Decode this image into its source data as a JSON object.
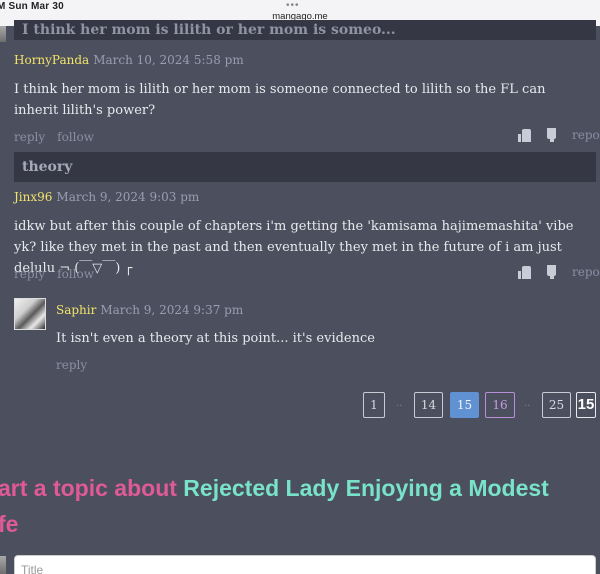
{
  "status_bar": {
    "time": "M  Sun Mar 30",
    "dots": "•••",
    "url": "mangago.me"
  },
  "comments": [
    {
      "topic_title": "I think her mom is lilith or her mom is someo...",
      "user": "HornyPanda",
      "date": "March 10, 2024 5:58 pm",
      "text": "I think her mom is lilith or her mom is someone connected to lilith so the FL can inherit lilith's power?",
      "reply_label": "reply",
      "follow_label": "follow",
      "report_label": "report"
    },
    {
      "topic_title": "theory",
      "user": "Jinx96",
      "date": "March 9, 2024 9:03 pm",
      "text": "idkw but after this couple of chapters i'm getting the 'kamisama hajimemashita' vibe yk? like they met in the past and then eventually they met in the future of i am just delulu ¬ (￣▽￣) ┌",
      "reply_label": "reply",
      "follow_label": "follow",
      "report_label": "report"
    }
  ],
  "reply": {
    "user": "Saphir",
    "date": "March 9, 2024 9:37 pm",
    "text": "It isn't even a theory at this point... it's evidence",
    "reply_label": "reply"
  },
  "pagination": {
    "pages": [
      "1",
      "14",
      "15",
      "16",
      "25",
      "15"
    ],
    "ellipsis": "..",
    "current": "15"
  },
  "start_topic": {
    "prefix": "art a topic about ",
    "title_line1": "Rejected Lady Enjoying a Modest",
    "title_line2_prefix": "fe"
  },
  "title_input": {
    "placeholder": "Title"
  },
  "colors": {
    "username": "#f2e36a",
    "current_page": "#5f91d3",
    "heading_pink": "#e05a97",
    "heading_teal": "#79e3c9"
  }
}
